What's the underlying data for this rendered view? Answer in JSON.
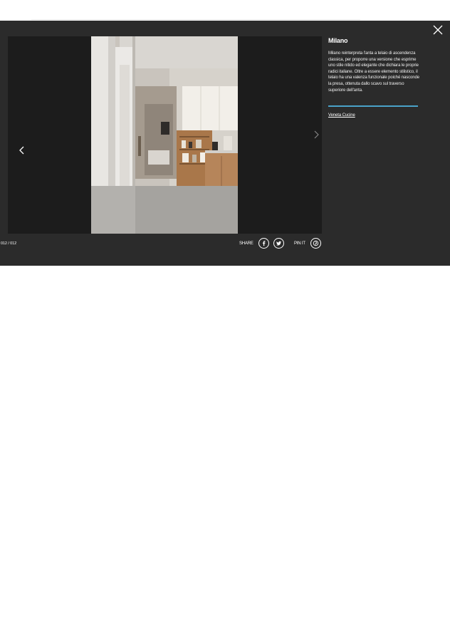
{
  "lightbox": {
    "caption": {
      "title": "Milano",
      "body": "Milano reinterpreta l'anta a telaio di ascendenza classica, per proporre una versione che esprime uno stile nitido ed elegante che dichiara le proprie radici italiane. Oltre a essere elemento stilistico, il telaio ha una valenza funzionale poiché nasconde la presa, ottenuta dallo scavo sul traverso superiore dell'anta.",
      "brand_link": "Veneta Cucine"
    },
    "counter": "012 / 012",
    "share_label": "SHARE",
    "pin_label": "PIN IT",
    "icons": {
      "close": "close-icon",
      "prev": "chevron-left-icon",
      "next": "chevron-right-icon",
      "facebook": "facebook-icon",
      "twitter": "twitter-icon",
      "pinterest": "pinterest-icon"
    },
    "colors": {
      "overlay": "#2b2b2b",
      "stage": "#1c1c1c",
      "accent_rule": "#4aa3c9"
    }
  }
}
